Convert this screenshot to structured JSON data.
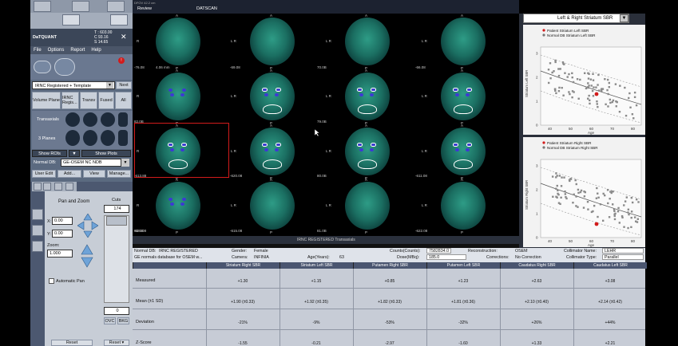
{
  "left_panel": {
    "info_name": "DaTQUANT",
    "info_lines": [
      "T : 603.00",
      "C 93.16",
      "S 14.65"
    ],
    "menu": [
      "File",
      "Options",
      "Report",
      "Help"
    ],
    "protocol": "IRNC Registered + Template",
    "next_label": "Next",
    "view_tabs": [
      "Volume Plane",
      "IRNC Regis...",
      "Transv",
      "Fused",
      "All"
    ],
    "transaxials_label": "Transaxials",
    "planes_label": "3 Planes",
    "show_rois": "Show ROIs",
    "show_plots": "Show Plots",
    "normal_db_label": "Normal DB:",
    "normal_db_value": "GE-OSEM NC NDB",
    "buttons": [
      "User Edit",
      "Add...",
      "View",
      "Manage..."
    ],
    "pan_zoom_title": "Pan and Zoom",
    "x_label": "X:",
    "x_value": "0.00",
    "y_label": "Y:",
    "y_value": "0.00",
    "zoom_label": "Zoom:",
    "zoom_value": "1.000",
    "auto_pan": "Automatic Pan",
    "reset": "Reset",
    "reset2": "Reset",
    "cuts_label": "Cuts",
    "cuts_value": "174",
    "cuts_bottom": "0",
    "ovc": "OVC",
    "bkg": "BKG"
  },
  "top": {
    "tab_review": "Review",
    "tab_datscan": "DATSCAN",
    "orient_a": "A",
    "orient_p": "P",
    "orient_r": "R",
    "orient_l": "L R",
    "orient_l2": "L",
    "corner": "DFOV 42.2 cm"
  },
  "viewer": {
    "row_labels": [
      "70.0B",
      "79.0B",
      "80.0B",
      "81.0B",
      "82.0B",
      "83.0B"
    ],
    "coord_labels": [
      "-76.08",
      "4.06 mm",
      "-69.08",
      "-66.08",
      "-620.08",
      "-611.08",
      "-613.88",
      "-615.08",
      "-622.08",
      "-624.08"
    ],
    "caption": "IRNC REGISTERED Transaxials"
  },
  "plots": {
    "selector": "Left & Right Striatum SBR",
    "plot1_legend": [
      "Patient Striatum Left SBR",
      "Normal DB Striatum Left SBR"
    ],
    "plot2_legend": [
      "Patient Striatum Right SBR",
      "Normal DB Striatum Right SBR"
    ],
    "xlabel": "Age",
    "ylabel1": "Striatum Left SBR",
    "ylabel2": "Striatum Right SBR",
    "xticks": [
      "40",
      "50",
      "60",
      "70",
      "80"
    ],
    "yticks": [
      "0",
      "1",
      "2",
      "3"
    ],
    "accent": "#d21b1b"
  },
  "info": {
    "normal_db_label": "Normal DB:",
    "normal_db_value": "IRNC REGISTERED",
    "normal_db_desc": "GE normals database for OSEM w...",
    "gender_label": "Gender:",
    "gender_value": "Female",
    "counts_label": "Counts(Counts):",
    "counts_value": "7582834.0",
    "recon_label": "Reconstruction:",
    "recon_value": "OSEM",
    "collimator_name_label": "Collimator Name:",
    "collimator_name_value": "LEHR",
    "camera_label": "Camera:",
    "camera_value": "INFINIA",
    "age_label": "Age(Years):",
    "age_value": "63",
    "dose_label": "Dose(MBq):",
    "dose_value": "185.0",
    "corrections_label": "Corrections:",
    "corrections_value": "No Correction",
    "collimator_type_label": "Collimator Type:",
    "collimator_type_value": "Parallel"
  },
  "table": {
    "headers": [
      "Striatum Right SBR",
      "Striatum Left SBR",
      "Putamen Right SBR",
      "Putamen Left SBR",
      "Caudatus Right SBR",
      "Caudatus Left SBR"
    ],
    "rows": [
      {
        "label": "Measured",
        "values": [
          "+1.30",
          "+1.15",
          "+0.85",
          "+1.23",
          "+2.63",
          "+3.08"
        ]
      },
      {
        "label": "Mean (±1 SD)",
        "values": [
          "+1.90 (±0.33)",
          "+1.92 (±0.35)",
          "+1.82 (±0.33)",
          "+1.81 (±0.36)",
          "+2.10 (±0.40)",
          "+2.14 (±0.42)"
        ]
      },
      {
        "label": "Deviation",
        "values": [
          "-21%",
          "-9%",
          "-53%",
          "-32%",
          "+26%",
          "+44%"
        ]
      },
      {
        "label": "Z-Score",
        "values": [
          "-1.55",
          "-0.21",
          "-2.97",
          "-1.60",
          "+1.33",
          "+2.21"
        ]
      }
    ]
  }
}
